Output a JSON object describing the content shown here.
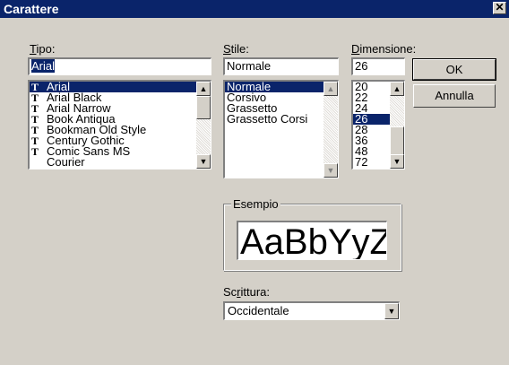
{
  "dialog": {
    "title": "Carattere",
    "close_glyph": "✕"
  },
  "tipo": {
    "label": "Tipo:",
    "accel": "T",
    "label_rest": "ipo:",
    "value": "Arial",
    "fonts": [
      {
        "name": "Arial",
        "selected": true
      },
      {
        "name": "Arial Black",
        "selected": false
      },
      {
        "name": "Arial Narrow",
        "selected": false
      },
      {
        "name": "Book Antiqua",
        "selected": false
      },
      {
        "name": "Bookman Old Style",
        "selected": false
      },
      {
        "name": "Century Gothic",
        "selected": false
      },
      {
        "name": "Comic Sans MS",
        "selected": false
      },
      {
        "name": "Courier",
        "selected": false
      }
    ],
    "truetype_glyph": "T"
  },
  "stile": {
    "label": "Stile:",
    "accel": "S",
    "label_rest": "tile:",
    "value": "Normale",
    "styles": [
      {
        "name": "Normale",
        "selected": true
      },
      {
        "name": "Corsivo",
        "selected": false
      },
      {
        "name": "Grassetto",
        "selected": false
      },
      {
        "name": "Grassetto Corsi",
        "selected": false
      }
    ]
  },
  "dimensione": {
    "label": "Dimensione:",
    "accel": "D",
    "label_rest": "imensione:",
    "value": "26",
    "sizes": [
      {
        "name": "20",
        "selected": false
      },
      {
        "name": "22",
        "selected": false
      },
      {
        "name": "24",
        "selected": false
      },
      {
        "name": "26",
        "selected": true
      },
      {
        "name": "28",
        "selected": false
      },
      {
        "name": "36",
        "selected": false
      },
      {
        "name": "48",
        "selected": false
      },
      {
        "name": "72",
        "selected": false
      }
    ]
  },
  "buttons": {
    "ok_label": "OK",
    "cancel_label": "Annulla"
  },
  "esempio": {
    "label": "Esempio",
    "sample_text": "AaBbYyZz"
  },
  "scrittura": {
    "label_pre": "Sc",
    "accel": "r",
    "label_rest": "ittura:",
    "value": "Occidentale"
  },
  "icons": {
    "scroll_up": "▲",
    "scroll_down": "▼"
  },
  "colors": {
    "title_bar": "#0a246a",
    "selection": "#0a246a",
    "face": "#d4d0c8"
  }
}
